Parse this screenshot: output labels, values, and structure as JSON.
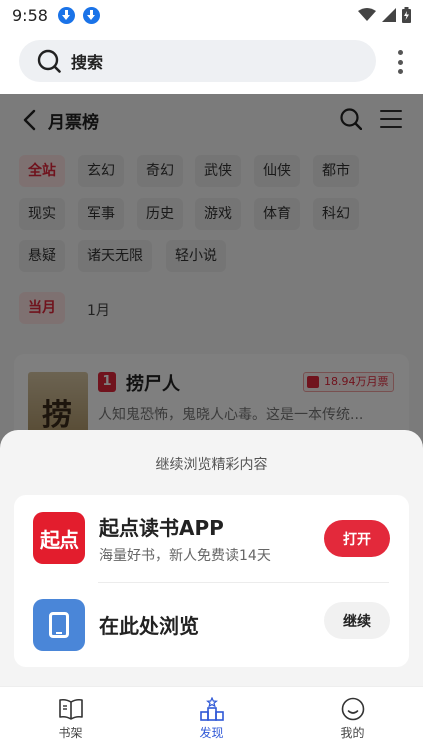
{
  "status_bar": {
    "time": "9:58"
  },
  "browser": {
    "search_text": "搜索"
  },
  "page": {
    "title": "月票榜",
    "categories": [
      "全站",
      "玄幻",
      "奇幻",
      "武侠",
      "仙侠",
      "都市",
      "现实",
      "军事",
      "历史",
      "游戏",
      "体育",
      "科幻",
      "悬疑",
      "诸天无限",
      "轻小说"
    ],
    "selected_category": "全站",
    "period_selected": "当月",
    "month": "1月",
    "book": {
      "rank": "1",
      "title": "捞尸人",
      "votes": "18.94万月票",
      "description": "人知鬼恐怖，鬼晓人心毒。这是一本传统...",
      "cover_text": "捞尸"
    }
  },
  "sheet": {
    "title": "继续浏览精彩内容",
    "app": {
      "name": "起点读书APP",
      "icon_text": "起点",
      "subtitle": "海量好书，新人免费读14天",
      "button": "打开"
    },
    "browser_option": {
      "name": "在此处浏览",
      "button": "继续"
    }
  },
  "bottom_nav": [
    {
      "label": "书架",
      "icon": "book-icon"
    },
    {
      "label": "发现",
      "icon": "discover-icon"
    },
    {
      "label": "我的",
      "icon": "smile-icon"
    }
  ],
  "colors": {
    "accent_red": "#e3293b",
    "nav_active": "#2f58d6",
    "download_blue": "#1a73e8"
  }
}
